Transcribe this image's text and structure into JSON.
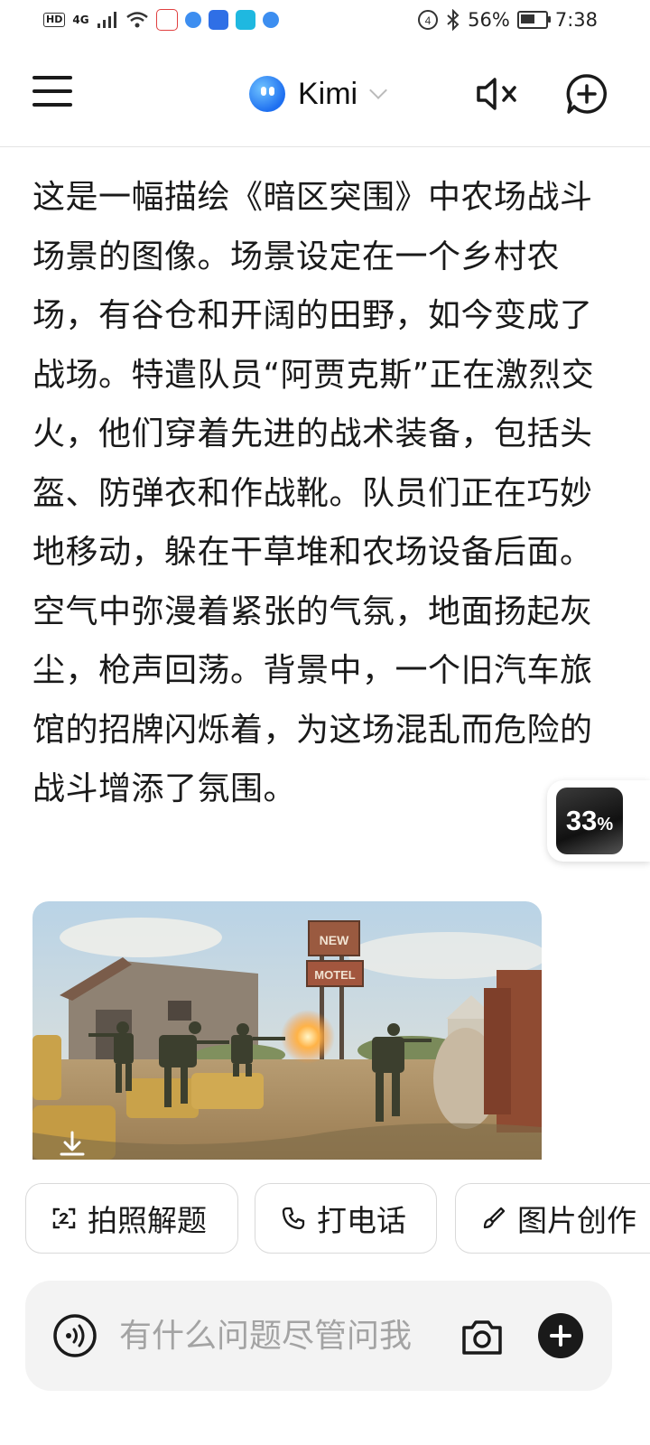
{
  "status_bar": {
    "hd_tag": "HD",
    "network": "4G",
    "battery_text": "56%",
    "battery_level": 0.56,
    "time": "7:38",
    "icons": [
      "hd-icon",
      "signal-icon",
      "wifi-icon",
      "app-notification-icon",
      "bluetooth-icon",
      "battery-icon"
    ]
  },
  "header": {
    "title": "Kimi",
    "icons": {
      "menu": "menu-icon",
      "mute": "speaker-mute-icon",
      "new_chat": "new-chat-icon"
    }
  },
  "message": {
    "text": "这是一幅描绘《暗区突围》中农场战斗场景的图像。场景设定在一个乡村农场，有谷仓和开阔的田野，如今变成了战场。特遣队员“阿贾克斯”正在激烈交火，他们穿着先进的战术装备，包括头盔、防弹衣和作战靴。队员们正在巧妙地移动，躲在干草堆和农场设备后面。空气中弥漫着紧张的气氛，地面扬起灰尘，枪声回荡。背景中，一个旧汽车旅馆的招牌闪烁着，为这场混乱而危险的战斗增添了氛围。"
  },
  "generated_image": {
    "sign_top": "NEW",
    "sign_bottom": "MOTEL"
  },
  "float_progress": {
    "percent": "33",
    "unit": "%"
  },
  "chips": [
    {
      "label": "拍照解题",
      "icon": "scan-icon"
    },
    {
      "label": "打电话",
      "icon": "phone-icon"
    },
    {
      "label": "图片创作",
      "icon": "brush-icon"
    }
  ],
  "input": {
    "placeholder": "有什么问题尽管问我",
    "value": ""
  },
  "colors": {
    "accent": "#1e6ff0",
    "text": "#1a1a1a",
    "input_bg": "#f3f3f3"
  }
}
